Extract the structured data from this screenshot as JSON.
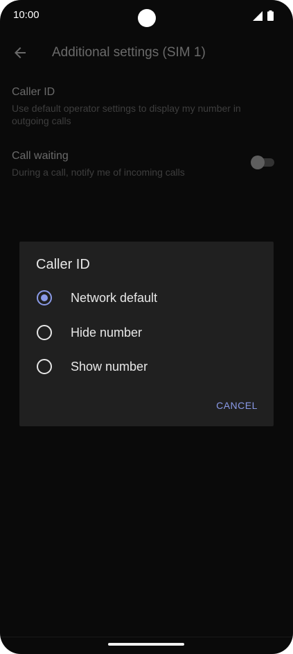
{
  "status_bar": {
    "time": "10:00"
  },
  "app_bar": {
    "title": "Additional settings (SIM 1)"
  },
  "settings": [
    {
      "title": "Caller ID",
      "summary": "Use default operator settings to display my number in outgoing calls"
    },
    {
      "title": "Call waiting",
      "summary": "During a call, notify me of incoming calls",
      "toggle_on": false
    }
  ],
  "dialog": {
    "title": "Caller ID",
    "options": [
      {
        "label": "Network default",
        "selected": true
      },
      {
        "label": "Hide number",
        "selected": false
      },
      {
        "label": "Show number",
        "selected": false
      }
    ],
    "cancel_label": "CANCEL"
  },
  "colors": {
    "accent": "#8a9ae8",
    "background": "#0a0a0a",
    "dialog": "#202020"
  }
}
